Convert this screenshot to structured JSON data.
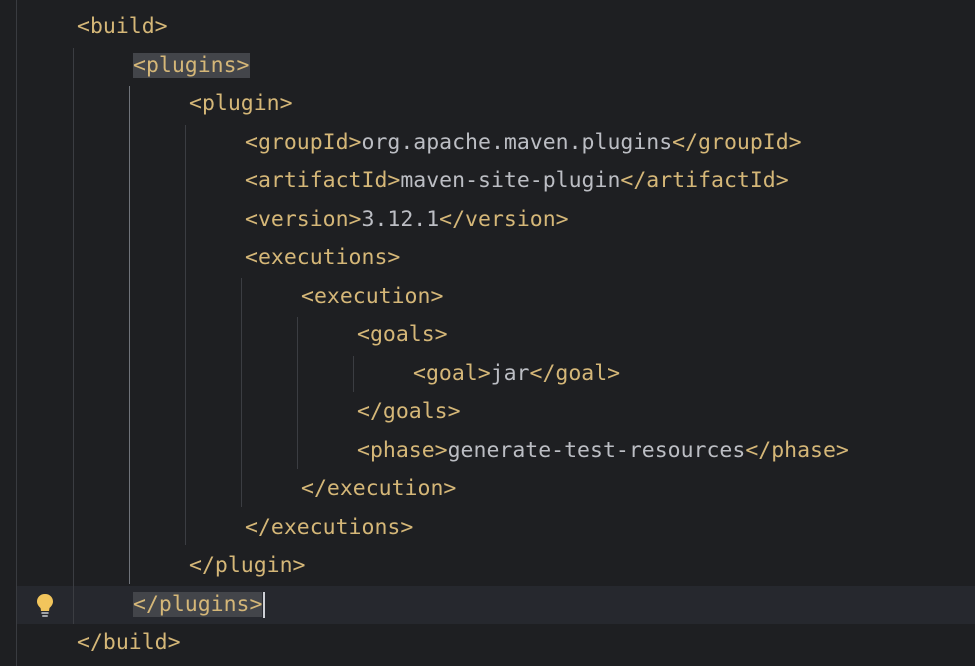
{
  "editor": {
    "lines": [
      {
        "open": "<build>"
      },
      {
        "open": "<plugins>"
      },
      {
        "open": "<plugin>"
      },
      {
        "open": "<groupId>",
        "text": "org.apache.maven.plugins",
        "close": "</groupId>"
      },
      {
        "open": "<artifactId>",
        "text": "maven-site-plugin",
        "close": "</artifactId>"
      },
      {
        "open": "<version>",
        "text": "3.12.1",
        "close": "</version>"
      },
      {
        "open": "<executions>"
      },
      {
        "open": "<execution>"
      },
      {
        "open": "<goals>"
      },
      {
        "open": "<goal>",
        "text": "jar",
        "close": "</goal>"
      },
      {
        "open": "</goals>"
      },
      {
        "open": "<phase>",
        "text": "generate-test-resources",
        "close": "</phase>"
      },
      {
        "open": "</execution>"
      },
      {
        "open": "</executions>"
      },
      {
        "open": "</plugin>"
      },
      {
        "open": "</plugins>"
      },
      {
        "open": "</build>"
      }
    ]
  },
  "icons": {
    "intention": "lightbulb-icon"
  },
  "colors": {
    "background": "#1e1f22",
    "tag": "#d5b778",
    "text": "#bcbec4",
    "match_highlight": "#43454a",
    "current_line": "#26282e"
  }
}
